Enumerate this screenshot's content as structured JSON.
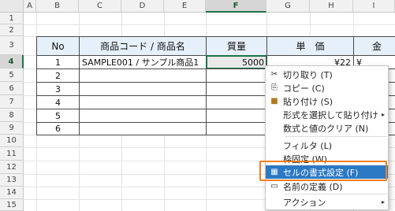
{
  "columns": [
    "A",
    "B",
    "C",
    "D",
    "E",
    "F",
    "G",
    "H",
    "I"
  ],
  "rows": [
    "1",
    "2",
    "3",
    "4",
    "5",
    "6",
    "7",
    "8",
    "9",
    "10",
    "11",
    "12",
    "13",
    "14",
    "15"
  ],
  "table": {
    "headers": {
      "no": "No",
      "product": "商品コード / 商品名",
      "weight": "質量",
      "unit_price": "単　価",
      "amount": "金"
    },
    "rows": [
      {
        "no": "1",
        "product": "SAMPLE001 / サンプル商品1",
        "weight": "5000",
        "unit_price": "¥22",
        "amount": "¥"
      },
      {
        "no": "2",
        "product": "",
        "weight": "",
        "unit_price": "",
        "amount": ""
      },
      {
        "no": "3",
        "product": "",
        "weight": "",
        "unit_price": "",
        "amount": ""
      },
      {
        "no": "4",
        "product": "",
        "weight": "",
        "unit_price": "",
        "amount": ""
      },
      {
        "no": "5",
        "product": "",
        "weight": "",
        "unit_price": "",
        "amount": ""
      },
      {
        "no": "6",
        "product": "",
        "weight": "",
        "unit_price": "",
        "amount": ""
      }
    ]
  },
  "context_menu": {
    "items": [
      {
        "label": "切り取り (T)",
        "icon": "scissors-icon",
        "glyph": "✂"
      },
      {
        "label": "コピー (C)",
        "icon": "copy-icon",
        "glyph": "⎘"
      },
      {
        "label": "貼り付け (S)",
        "icon": "paste-icon",
        "glyph": "📋"
      },
      {
        "label": "形式を選択して貼り付け",
        "icon": "",
        "glyph": "",
        "submenu": "▸"
      },
      {
        "label": "数式と値のクリア (N)",
        "icon": "",
        "glyph": ""
      },
      {
        "label": "フィルタ (L)",
        "icon": "",
        "glyph": ""
      },
      {
        "label": "枠固定 (W)",
        "icon": "",
        "glyph": ""
      },
      {
        "label": "セルの書式設定 (F)",
        "icon": "format-cells-icon",
        "glyph": "▦"
      },
      {
        "label": "名前の定義 (D)",
        "icon": "define-name-icon",
        "glyph": "▭"
      },
      {
        "label": "アクション",
        "icon": "",
        "glyph": "",
        "submenu": "▸"
      }
    ]
  },
  "colors": {
    "accent": "#217346",
    "highlight": "#2b78c5",
    "callout": "#f07f1e",
    "header_fill": "#e6f0fa"
  }
}
